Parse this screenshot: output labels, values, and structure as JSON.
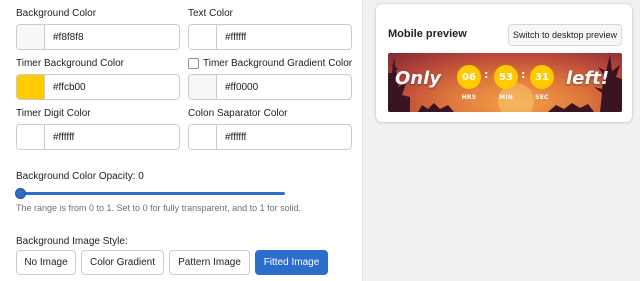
{
  "settings": {
    "background_color": {
      "label": "Background Color",
      "value": "#f8f8f8",
      "swatch": "#f8f8f8"
    },
    "text_color": {
      "label": "Text Color",
      "value": "#ffffff",
      "swatch": "#ffffff"
    },
    "timer_background_color": {
      "label": "Timer Background Color",
      "value": "#ffcb00",
      "swatch": "#ffcb00"
    },
    "timer_gradient_color": {
      "label": "Timer Background Gradient Color",
      "value": "#ff0000",
      "swatch": "#f4f6f8",
      "checked": false
    },
    "timer_digit_color": {
      "label": "Timer Digit Color",
      "value": "#ffffff",
      "swatch": "#ffffff"
    },
    "colon_separator_color": {
      "label": "Colon Saparator Color",
      "value": "#ffffff",
      "swatch": "#ffffff"
    },
    "opacity": {
      "label": "Background Color Opacity: 0",
      "value": 0,
      "help": "The range is from 0 to 1. Set to 0 for fully transparent, and to 1 for solid."
    },
    "image_style": {
      "label": "Background Image Style:",
      "options": [
        "No Image",
        "Color Gradient",
        "Pattern Image",
        "Fitted Image"
      ],
      "selected": "Fitted Image"
    }
  },
  "preview": {
    "title": "Mobile preview",
    "switch_label": "Switch to desktop preview",
    "banner": {
      "before": "Only",
      "after": "left!",
      "hours": "06",
      "minutes": "53",
      "seconds": "31",
      "separator": ":",
      "hours_unit": "HRS",
      "minutes_unit": "MIN",
      "seconds_unit": "SEC"
    }
  },
  "colors": {
    "primary": "#2c6ecb",
    "timer": "#ffcb00"
  }
}
